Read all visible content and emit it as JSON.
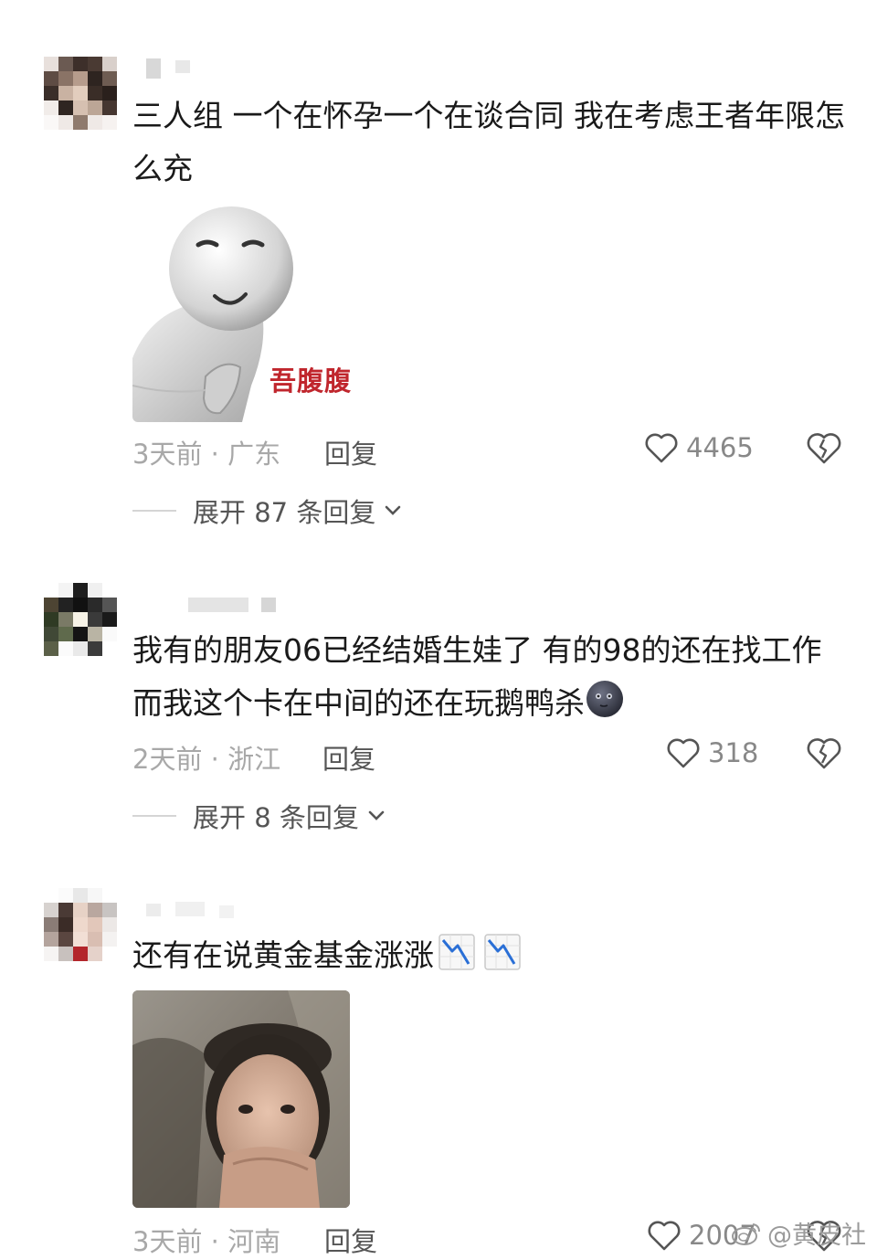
{
  "comments": [
    {
      "text": "三人组 一个在怀孕一个在谈合同 我在考虑王者年限怎么充",
      "sticker_caption": "吾腹腹",
      "time_location": "3天前 · 广东",
      "reply_label": "回复",
      "likes": "4465",
      "expand_label": "展开 87 条回复"
    },
    {
      "text": "我有的朋友06已经结婚生娃了 有的98的还在找工作 而我这个卡在中间的还在玩鹅鸭杀",
      "time_location": "2天前 · 浙江",
      "reply_label": "回复",
      "likes": "318",
      "expand_label": "展开 8 条回复"
    },
    {
      "text": "还有在说黄金基金涨涨",
      "time_location": "3天前 · 河南",
      "reply_label": "回复",
      "likes": "2007"
    }
  ],
  "watermark": "@黄皮社",
  "icons": [
    "heart-outline-icon",
    "broken-heart-icon",
    "chevron-down-icon",
    "chart-decreasing-icon",
    "new-moon-face-icon",
    "weibo-logo-icon"
  ],
  "colors": {
    "text": "#1a1a1a",
    "meta": "#a8a8a8",
    "reply": "#555555",
    "sticker_caption": "#c0262d"
  }
}
